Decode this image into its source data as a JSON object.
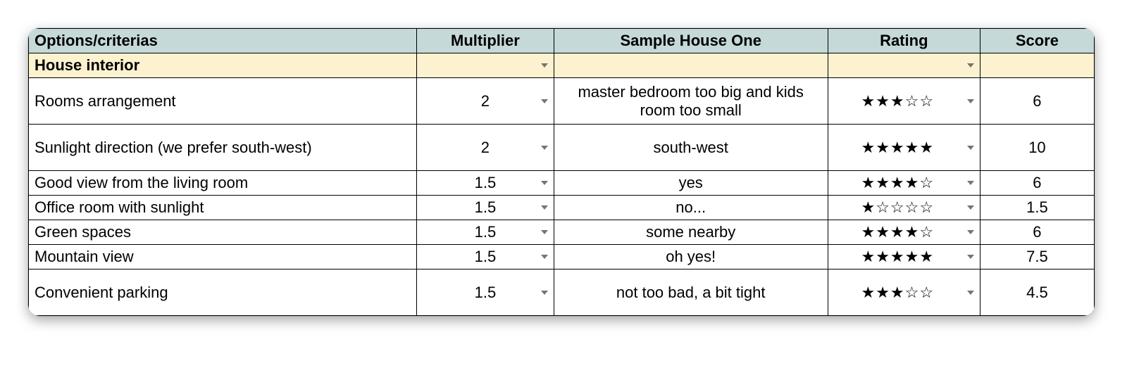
{
  "headers": {
    "criteria": "Options/criterias",
    "multiplier": "Multiplier",
    "sample": "Sample House One",
    "rating": "Rating",
    "score": "Score"
  },
  "section": {
    "label": "House interior"
  },
  "rows": [
    {
      "criteria": "Rooms arrangement",
      "multiplier": "2",
      "sample": "master bedroom too big and kids room too small",
      "rating_stars": 3,
      "score": "6",
      "tall": true
    },
    {
      "criteria": "Sunlight direction (we prefer south-west)",
      "multiplier": "2",
      "sample": "south-west",
      "rating_stars": 5,
      "score": "10",
      "tall": true
    },
    {
      "criteria": "Good view from the living room",
      "multiplier": "1.5",
      "sample": "yes",
      "rating_stars": 4,
      "score": "6"
    },
    {
      "criteria": "Office room with sunlight",
      "multiplier": "1.5",
      "sample": "no...",
      "rating_stars": 1,
      "score": "1.5"
    },
    {
      "criteria": "Green spaces",
      "multiplier": "1.5",
      "sample": "some nearby",
      "rating_stars": 4,
      "score": "6"
    },
    {
      "criteria": "Mountain view",
      "multiplier": "1.5",
      "sample": "oh yes!",
      "rating_stars": 5,
      "score": "7.5"
    },
    {
      "criteria": "Convenient parking",
      "multiplier": "1.5",
      "sample": "not too bad, a bit tight",
      "rating_stars": 3,
      "score": "4.5",
      "tall": true
    }
  ]
}
